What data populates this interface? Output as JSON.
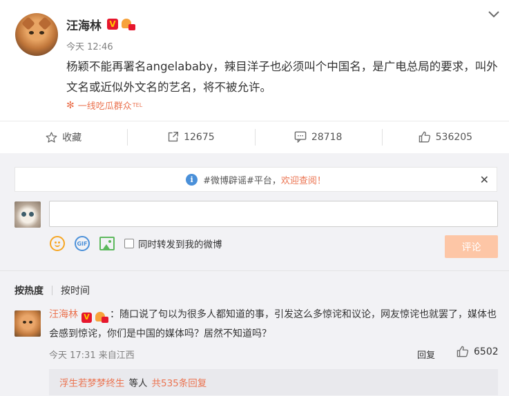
{
  "post": {
    "author": "汪海林",
    "time": "今天 12:46",
    "text": "杨颖不能再署名angelababy，辣目洋子也必须叫个中国名，是广电总局的要求，叫外文名或近似外文名的艺名，将不被允许。",
    "source": "一线吃瓜群众",
    "source_sup": "TEL"
  },
  "actions": {
    "favorite": "收藏",
    "repost_count": "12675",
    "comment_count": "28718",
    "like_count": "536205"
  },
  "notice": {
    "prefix": "#微博辟谣#平台，",
    "highlight": "欢迎查阅！"
  },
  "composer": {
    "input_value": "",
    "repost_label": "同时转发到我的微博",
    "submit_label": "评论"
  },
  "sort": {
    "by_hot": "按热度",
    "by_time": "按时间"
  },
  "comment": {
    "user": "汪海林",
    "text": "：随口说了句以为很多人都知道的事，引发这么多惊诧和议论，网友惊诧也就罢了，媒体也会感到惊诧，你们是中国的媒体吗？居然不知道吗？",
    "meta": "今天 17:31 来自江西",
    "reply_label": "回复",
    "likes": "6502",
    "sub_user": "浮生若梦梦终生",
    "sub_mid": "等人",
    "sub_count": "共535条回复"
  },
  "icons": {
    "v": "V",
    "gif": "GIF"
  }
}
